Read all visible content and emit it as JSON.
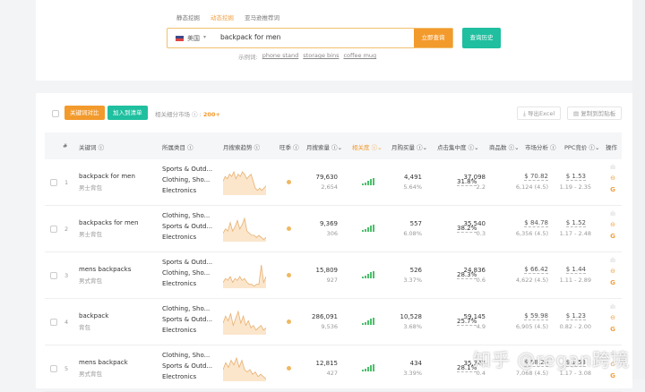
{
  "search": {
    "tabs": [
      "静态挖掘",
      "动态挖掘",
      "亚马逊推荐词"
    ],
    "active_tab": 1,
    "country": "美国",
    "query": "backpack for men",
    "search_button": "立即查询",
    "history_button": "查询历史",
    "examples_label": "示例词:",
    "examples": [
      "phone stand",
      "storage bins",
      "coffee mug"
    ]
  },
  "toolbar": {
    "compare_button": "关键词对比",
    "add_list_button": "加入到清单",
    "related_label": "相关细分市场",
    "related_count": "200+",
    "export_button": "导出Excel",
    "copy_button": "复制到剪贴板"
  },
  "columns": [
    "#",
    "关键词",
    "所属类目",
    "月搜索趋势",
    "旺季",
    "月搜索量",
    "相关度",
    "月购买量",
    "点击集中度",
    "商品数",
    "市场分析",
    "PPC竞价",
    "操作"
  ],
  "colors": {
    "orange": "#f39a2c",
    "teal": "#1fbf9f",
    "green": "#4cbf6a"
  },
  "rows": [
    {
      "n": "1",
      "kw": "backpack for men",
      "cn": "男士背包",
      "cats": [
        "Sports & Outd...",
        "Clothing, Sho...",
        "Electronics"
      ],
      "search": "79,630",
      "search_sub": "2,654",
      "buy": "4,491",
      "buy_sub": "5.64%",
      "click": "31.8%",
      "products": "37,098",
      "products_sub": "2.2",
      "price": "$ 70.82",
      "price_sub": "6,124 (4.5)",
      "ppc": "$ 1.53",
      "ppc_sub": "1.19 - 2.35",
      "trend": [
        6,
        8,
        7,
        9,
        8,
        10,
        7,
        9,
        8,
        10,
        9,
        7,
        8,
        9,
        6,
        3,
        2,
        3,
        2,
        3,
        4
      ]
    },
    {
      "n": "2",
      "kw": "backpacks for men",
      "cn": "男士背包",
      "cats": [
        "Clothing, Sho...",
        "Sports & Outd...",
        "Electronics"
      ],
      "search": "9,369",
      "search_sub": "306",
      "buy": "557",
      "buy_sub": "6.08%",
      "click": "38.2%",
      "products": "35,540",
      "products_sub": "0.3",
      "price": "$ 84.78",
      "price_sub": "6,356 (4.5)",
      "ppc": "$ 1.52",
      "ppc_sub": "1.17 - 2.48",
      "trend": [
        4,
        6,
        5,
        9,
        5,
        7,
        10,
        6,
        8,
        11,
        5,
        4,
        3,
        3,
        2,
        3,
        2,
        1,
        2
      ]
    },
    {
      "n": "3",
      "kw": "mens backpacks",
      "cn": "男式背包",
      "cats": [
        "Sports & Outd...",
        "Clothing, Sho...",
        "Electronics"
      ],
      "search": "15,809",
      "search_sub": "927",
      "buy": "526",
      "buy_sub": "3.37%",
      "click": "28.3%",
      "products": "24,836",
      "products_sub": "0.6",
      "price": "$ 66.42",
      "price_sub": "4,622 (4.5)",
      "ppc": "$ 1.44",
      "ppc_sub": "1.11 - 2.89",
      "trend": [
        3,
        5,
        4,
        6,
        3,
        5,
        4,
        6,
        4,
        5,
        3,
        2,
        2,
        1,
        2,
        2,
        12,
        3,
        6
      ]
    },
    {
      "n": "4",
      "kw": "backpack",
      "cn": "背包",
      "cats": [
        "Clothing, Sho...",
        "Sports & Outd...",
        "Electronics"
      ],
      "search": "286,091",
      "search_sub": "9,536",
      "buy": "10,528",
      "buy_sub": "3.68%",
      "click": "25.7%",
      "products": "59,145",
      "products_sub": "4.9",
      "price": "$ 59.98",
      "price_sub": "6,905 (4.5)",
      "ppc": "$ 1.23",
      "ppc_sub": "0.82 - 2.00",
      "trend": [
        5,
        8,
        6,
        9,
        4,
        7,
        10,
        5,
        8,
        4,
        6,
        3,
        4,
        2,
        3,
        4,
        2,
        3
      ]
    },
    {
      "n": "5",
      "kw": "mens backpack",
      "cn": "男式背包",
      "cats": [
        "Clothing, Sho...",
        "Sports & Outd...",
        "Electronics"
      ],
      "search": "12,815",
      "search_sub": "427",
      "buy": "434",
      "buy_sub": "3.39%",
      "click": "28.1%",
      "products": "35,347",
      "products_sub": "0.4",
      "price": "$ 58.20",
      "price_sub": "7,068 (4.5)",
      "ppc": "$ 1.53",
      "ppc_sub": "1.17 - 3.08",
      "trend": [
        5,
        8,
        6,
        9,
        7,
        10,
        6,
        9,
        5,
        4,
        5,
        3,
        4,
        2,
        3,
        2,
        1
      ]
    }
  ],
  "watermark": "知乎 @regan跨境"
}
